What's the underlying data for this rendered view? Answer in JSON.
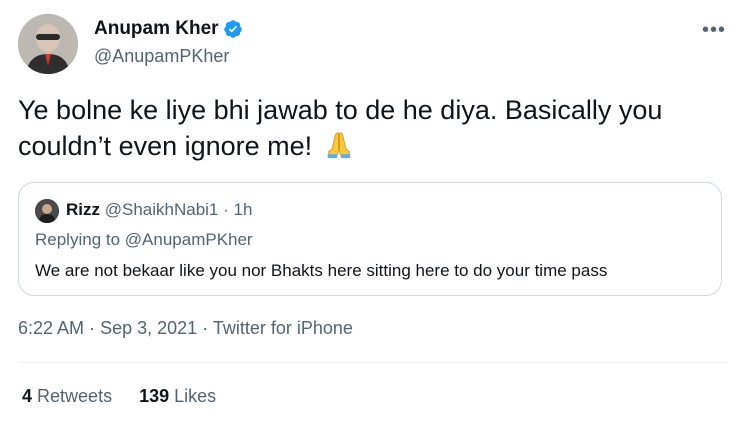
{
  "author": {
    "display_name": "Anupam Kher",
    "handle": "@AnupamPKher",
    "verified": true,
    "verified_color": "#1d9bf0"
  },
  "more_icon": "•••",
  "tweet": {
    "text": "Ye bolne ke liye bhi jawab to de he diya. Basically you couldn’t even ignore me!",
    "emoji": "folded-hands"
  },
  "quote": {
    "display_name": "Rizz",
    "handle": "@ShaikhNabi1",
    "separator": "·",
    "time": "1h",
    "replying_to": "Replying to @AnupamPKher",
    "text": "We are not bekaar like you nor Bhakts here sitting here to do your time pass"
  },
  "meta": {
    "time": "6:22 AM",
    "date": "Sep 3, 2021",
    "source": "Twitter for iPhone",
    "separator": "·"
  },
  "stats": {
    "retweets_count": "4",
    "retweets_label": "Retweets",
    "likes_count": "139",
    "likes_label": "Likes"
  },
  "colors": {
    "text_primary": "#0f1419",
    "text_secondary": "#536471",
    "border": "#cfd9de"
  }
}
